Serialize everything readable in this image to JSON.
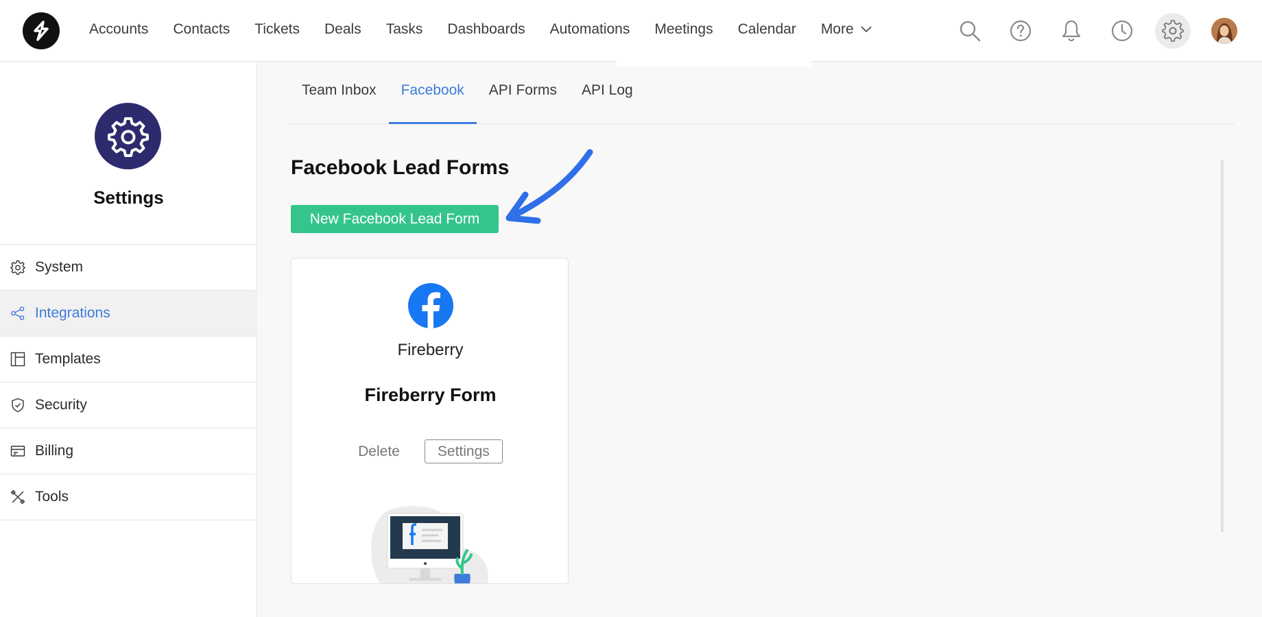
{
  "topnav": {
    "items": [
      "Accounts",
      "Contacts",
      "Tickets",
      "Deals",
      "Tasks",
      "Dashboards",
      "Automations",
      "Meetings",
      "Calendar"
    ],
    "more_label": "More",
    "icons": [
      "search-icon",
      "help-icon",
      "bell-icon",
      "clock-icon",
      "gear-icon"
    ]
  },
  "sidebar": {
    "title": "Settings",
    "items": [
      {
        "label": "System",
        "icon": "gear-icon"
      },
      {
        "label": "Integrations",
        "icon": "share-icon"
      },
      {
        "label": "Templates",
        "icon": "template-icon"
      },
      {
        "label": "Security",
        "icon": "shield-icon"
      },
      {
        "label": "Billing",
        "icon": "billing-icon"
      },
      {
        "label": "Tools",
        "icon": "tools-icon"
      }
    ],
    "active": "Integrations"
  },
  "tabs": {
    "items": [
      "Team Inbox",
      "Facebook",
      "API Forms",
      "API Log"
    ],
    "active": "Facebook"
  },
  "main": {
    "section_title": "Facebook Lead Forms",
    "new_button_label": "New Facebook Lead Form"
  },
  "card": {
    "page_name": "Fireberry",
    "form_name": "Fireberry Form",
    "delete_label": "Delete",
    "settings_label": "Settings"
  },
  "colors": {
    "accent": "#3e7bdb",
    "button_green": "#35c58c",
    "settings_circle": "#2d2a6e",
    "facebook_blue": "#1877f2",
    "arrow_blue": "#2f6fe8"
  }
}
